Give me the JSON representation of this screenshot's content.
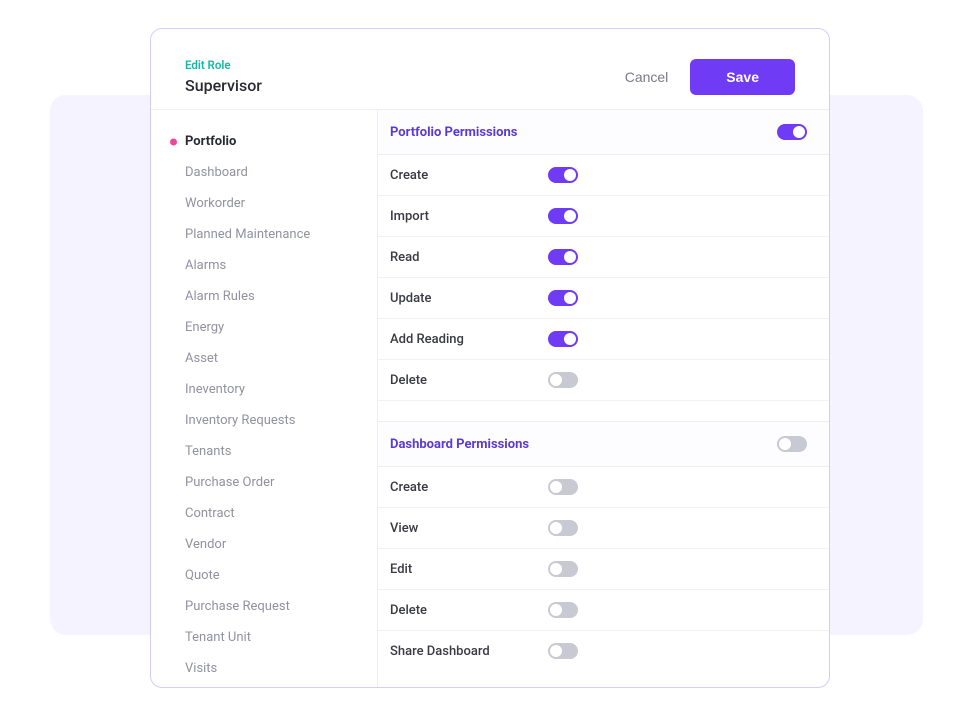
{
  "header": {
    "editLabel": "Edit Role",
    "roleName": "Supervisor",
    "cancel": "Cancel",
    "save": "Save"
  },
  "sidebar": {
    "items": [
      {
        "label": "Portfolio",
        "active": true
      },
      {
        "label": "Dashboard",
        "active": false
      },
      {
        "label": "Workorder",
        "active": false
      },
      {
        "label": "Planned Maintenance",
        "active": false
      },
      {
        "label": "Alarms",
        "active": false
      },
      {
        "label": "Alarm Rules",
        "active": false
      },
      {
        "label": "Energy",
        "active": false
      },
      {
        "label": "Asset",
        "active": false
      },
      {
        "label": "Ineventory",
        "active": false
      },
      {
        "label": "Inventory Requests",
        "active": false
      },
      {
        "label": "Tenants",
        "active": false
      },
      {
        "label": "Purchase Order",
        "active": false
      },
      {
        "label": "Contract",
        "active": false
      },
      {
        "label": "Vendor",
        "active": false
      },
      {
        "label": "Quote",
        "active": false
      },
      {
        "label": "Purchase Request",
        "active": false
      },
      {
        "label": "Tenant Unit",
        "active": false
      },
      {
        "label": "Visits",
        "active": false
      }
    ]
  },
  "sections": [
    {
      "title": "Portfolio Permissions",
      "masterToggle": true,
      "permissions": [
        {
          "label": "Create",
          "on": true
        },
        {
          "label": "Import",
          "on": true
        },
        {
          "label": "Read",
          "on": true
        },
        {
          "label": "Update",
          "on": true
        },
        {
          "label": "Add Reading",
          "on": true
        },
        {
          "label": "Delete",
          "on": false
        }
      ]
    },
    {
      "title": "Dashboard Permissions",
      "masterToggle": false,
      "permissions": [
        {
          "label": "Create",
          "on": false
        },
        {
          "label": "View",
          "on": false
        },
        {
          "label": "Edit",
          "on": false
        },
        {
          "label": "Delete",
          "on": false
        },
        {
          "label": "Share Dashboard",
          "on": false
        }
      ]
    }
  ]
}
